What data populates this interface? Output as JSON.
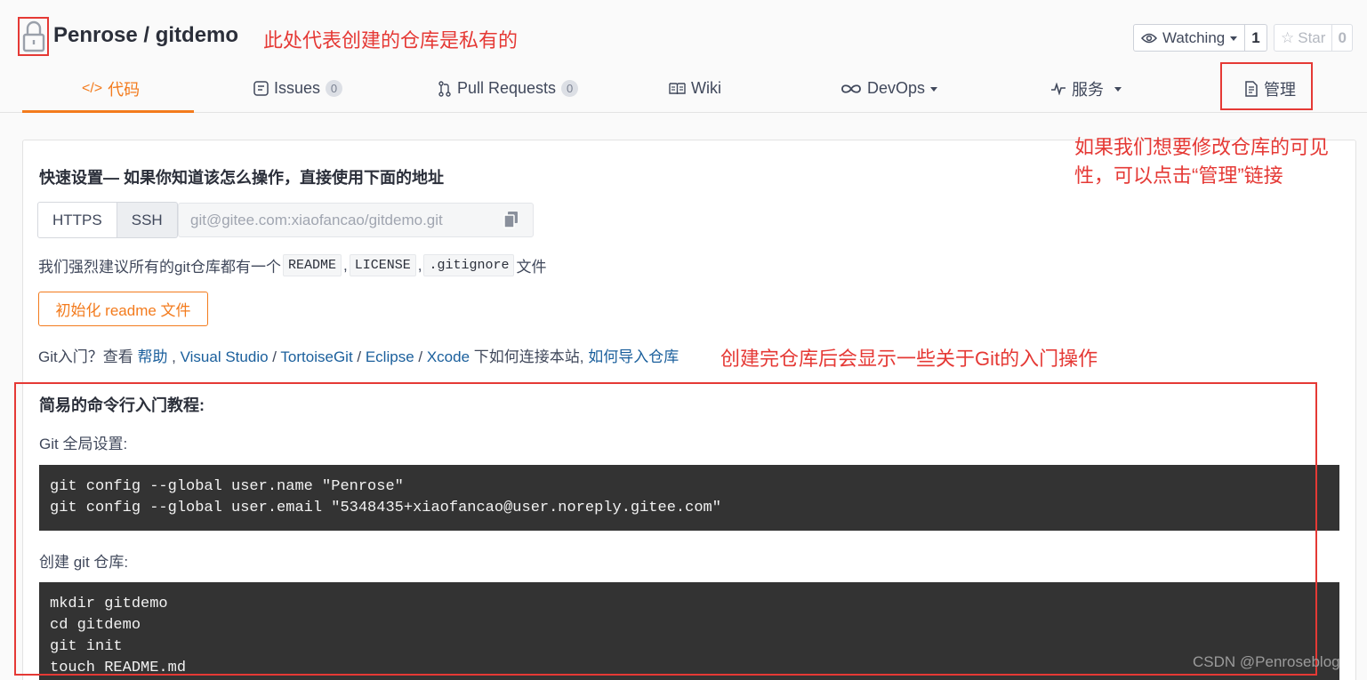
{
  "repo": {
    "title": "Penrose / gitdemo",
    "watch_label": "Watching",
    "watch_count": "1",
    "star_label": "Star",
    "star_count": "0"
  },
  "tabs": [
    {
      "label": "代码",
      "icon": "code-icon",
      "active": true
    },
    {
      "label": "Issues",
      "icon": "issues-icon",
      "badge": "0"
    },
    {
      "label": "Pull Requests",
      "icon": "pull-request-icon",
      "badge": "0"
    },
    {
      "label": "Wiki",
      "icon": "book-icon"
    },
    {
      "label": "DevOps",
      "icon": "infinity-icon"
    },
    {
      "label": "服务",
      "icon": "pulse-icon"
    },
    {
      "label": "管理",
      "icon": "document-icon"
    }
  ],
  "quick_setup": {
    "title": "快速设置— 如果你知道该怎么操作，直接使用下面的地址",
    "https_label": "HTTPS",
    "ssh_label": "SSH",
    "url": "git@gitee.com:xiaofancao/gitdemo.git"
  },
  "recommend": {
    "prefix": "我们强烈建议所有的git仓库都有一个",
    "readme": "README",
    "sep1": ",",
    "license": "LICENSE",
    "sep2": ",",
    "gitignore": ".gitignore",
    "suffix": "文件"
  },
  "init_button": "初始化 readme 文件",
  "git_links": {
    "prefix": "Git入门？查看 ",
    "help": "帮助",
    "sep1": " , ",
    "visual_studio": "Visual Studio",
    "sep2": " / ",
    "tortoisegit": "TortoiseGit",
    "sep3": " / ",
    "eclipse": "Eclipse",
    "sep4": " / ",
    "xcode": "Xcode",
    "middle": " 下如何连接本站, ",
    "import": "如何导入仓库"
  },
  "tutorial": {
    "title": "简易的命令行入门教程:",
    "step1_label": "Git 全局设置:",
    "step1_code": "git config --global user.name \"Penrose\"\ngit config --global user.email \"5348435+xiaofancao@user.noreply.gitee.com\"",
    "step2_label": "创建 git 仓库:",
    "step2_code": "mkdir gitdemo\ncd gitdemo\ngit init\ntouch README.md"
  },
  "annotations": {
    "private": "此处代表创建的仓库是私有的",
    "manage": "如果我们想要修改仓库的可见性，可以点击“管理”链接",
    "intro": "创建完仓库后会显示一些关于Git的入门操作"
  },
  "watermark": "CSDN @Penroseblog",
  "colors": {
    "accent": "#f37b1d",
    "link": "#1a5f9c",
    "annotation": "#e53935",
    "code_bg": "#333333"
  }
}
